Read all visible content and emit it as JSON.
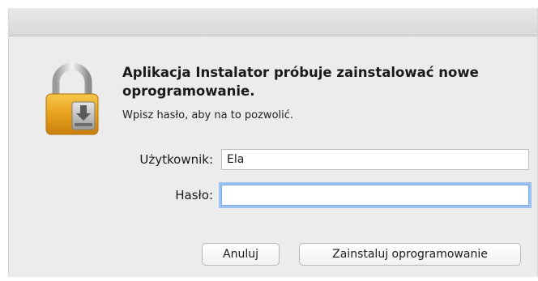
{
  "dialog": {
    "heading": "Aplikacja Instalator próbuje zainstalować nowe oprogramowanie.",
    "subtext": "Wpisz hasło, aby na to pozwolić.",
    "icon": "lock-installer-icon"
  },
  "form": {
    "username_label": "Użytkownik:",
    "username_value": "Ela",
    "password_label": "Hasło:",
    "password_value": ""
  },
  "buttons": {
    "cancel_label": "Anuluj",
    "install_label": "Zainstaluj oprogramowanie"
  },
  "colors": {
    "lock_gold": "#e8a21c",
    "focus_ring": "#9cc2f2",
    "background": "#ececec"
  }
}
